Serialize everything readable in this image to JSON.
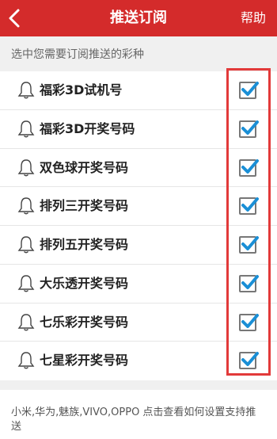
{
  "header": {
    "title": "推送订阅",
    "help_label": "帮助",
    "back_icon": "chevron-left-icon"
  },
  "section": {
    "label": "选中您需要订阅推送的彩种"
  },
  "subscriptions": [
    {
      "label": "福彩3D试机号",
      "checked": true
    },
    {
      "label": "福彩3D开奖号码",
      "checked": true
    },
    {
      "label": "双色球开奖号码",
      "checked": true
    },
    {
      "label": "排列三开奖号码",
      "checked": true
    },
    {
      "label": "排列五开奖号码",
      "checked": true
    },
    {
      "label": "大乐透开奖号码",
      "checked": true
    },
    {
      "label": "七乐彩开奖号码",
      "checked": true
    },
    {
      "label": "七星彩开奖号码",
      "checked": true
    }
  ],
  "footer": {
    "text": "小米,华为,魅族,VIVO,OPPO 点击查看如何设置支持推送"
  },
  "colors": {
    "header_bg": "#d42b2b",
    "check_color": "#1a8fd6",
    "highlight_border": "#e23a3a"
  }
}
